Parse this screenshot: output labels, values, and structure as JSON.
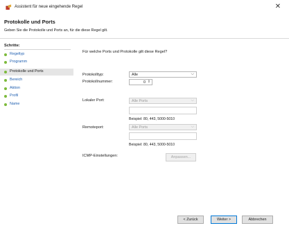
{
  "window": {
    "title": "Assistent für neue eingehende Regel",
    "close_glyph": "✕"
  },
  "header": {
    "title": "Protokolle und Ports",
    "subtitle": "Geben Sie die Protokolle und Ports an, für die diese Regel gilt."
  },
  "sidebar": {
    "heading": "Schritte:",
    "items": [
      {
        "label": "Regeltyp",
        "current": false
      },
      {
        "label": "Programm",
        "current": false
      },
      {
        "label": "Protokolle und Ports",
        "current": true
      },
      {
        "label": "Bereich",
        "current": false
      },
      {
        "label": "Aktion",
        "current": false
      },
      {
        "label": "Profil",
        "current": false
      },
      {
        "label": "Name",
        "current": false
      }
    ]
  },
  "main": {
    "question": "Für welche Ports und Protokolle gilt diese Regel?",
    "protocol_type": {
      "label": "Protokolltyp:",
      "value": "Alle"
    },
    "protocol_number": {
      "label": "Protokollnummer:",
      "value": "0"
    },
    "local_port": {
      "label": "Lokaler Port:",
      "value": "Alle Ports",
      "text": "",
      "example": "Beispiel: 80, 443, 5000-5010"
    },
    "remote_port": {
      "label": "Remoteport:",
      "value": "Alle Ports",
      "text": "",
      "example": "Beispiel: 80, 443, 5000-5010"
    },
    "icmp": {
      "label": "ICMP-Einstellungen:",
      "button": "Anpassen..."
    }
  },
  "footer": {
    "back": "< Zurück",
    "next": "Weiter >",
    "cancel": "Abbrechen"
  },
  "icons": {
    "app": "firewall-wizard-icon",
    "chevron": "chevron-down-icon",
    "spinner": "spinner-arrows-icon",
    "close": "close-icon"
  },
  "colors": {
    "step_dot": "#7cba3b",
    "step_link": "#1f5fb0",
    "current_step_bg": "#e5e5e5",
    "default_button_border": "#0078d7"
  }
}
